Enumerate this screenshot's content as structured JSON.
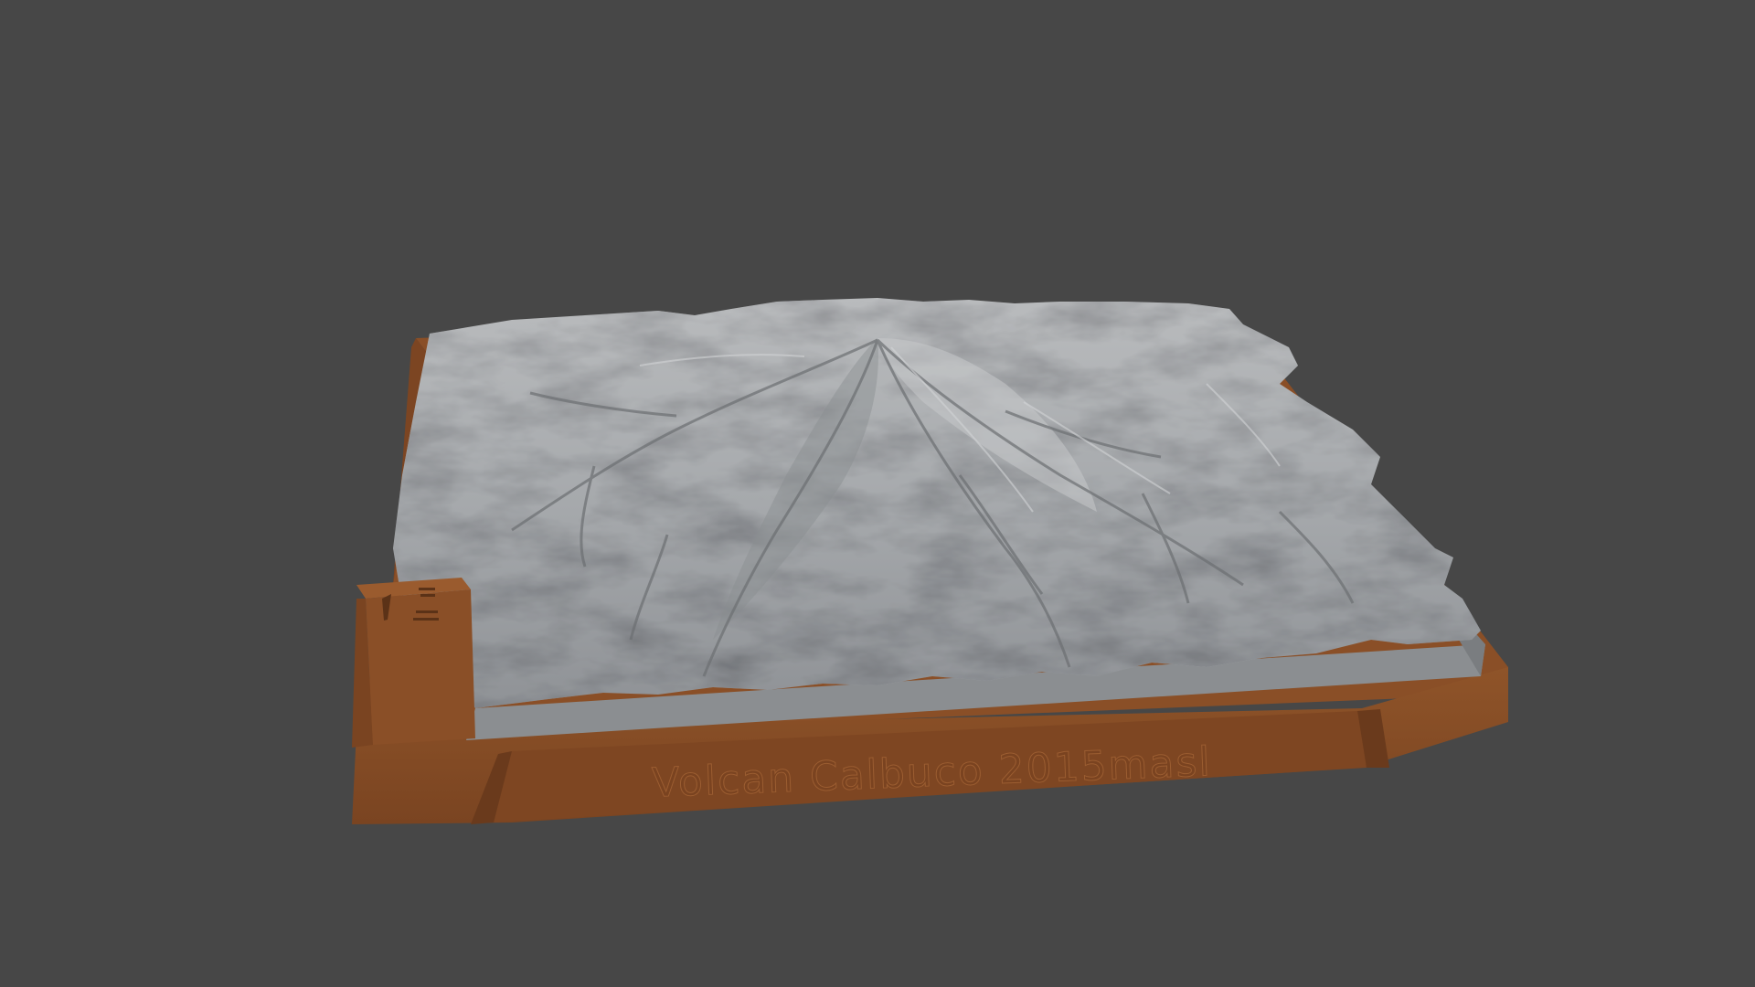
{
  "scene": {
    "background_color": "#474747",
    "base_color": "#8a4f27",
    "base_shadow_color": "#6a3a1c",
    "terrain_color": "#a9acae",
    "terrain_highlight_color": "#c4c6c8",
    "terrain_shadow_color": "#6c6f72",
    "object": "3D printed terrain relief model on wooden-colored base",
    "plaque_text": "Volcan Calbuco 2015masl",
    "side_block_icon": "north-arrow-and-scale-icon"
  }
}
